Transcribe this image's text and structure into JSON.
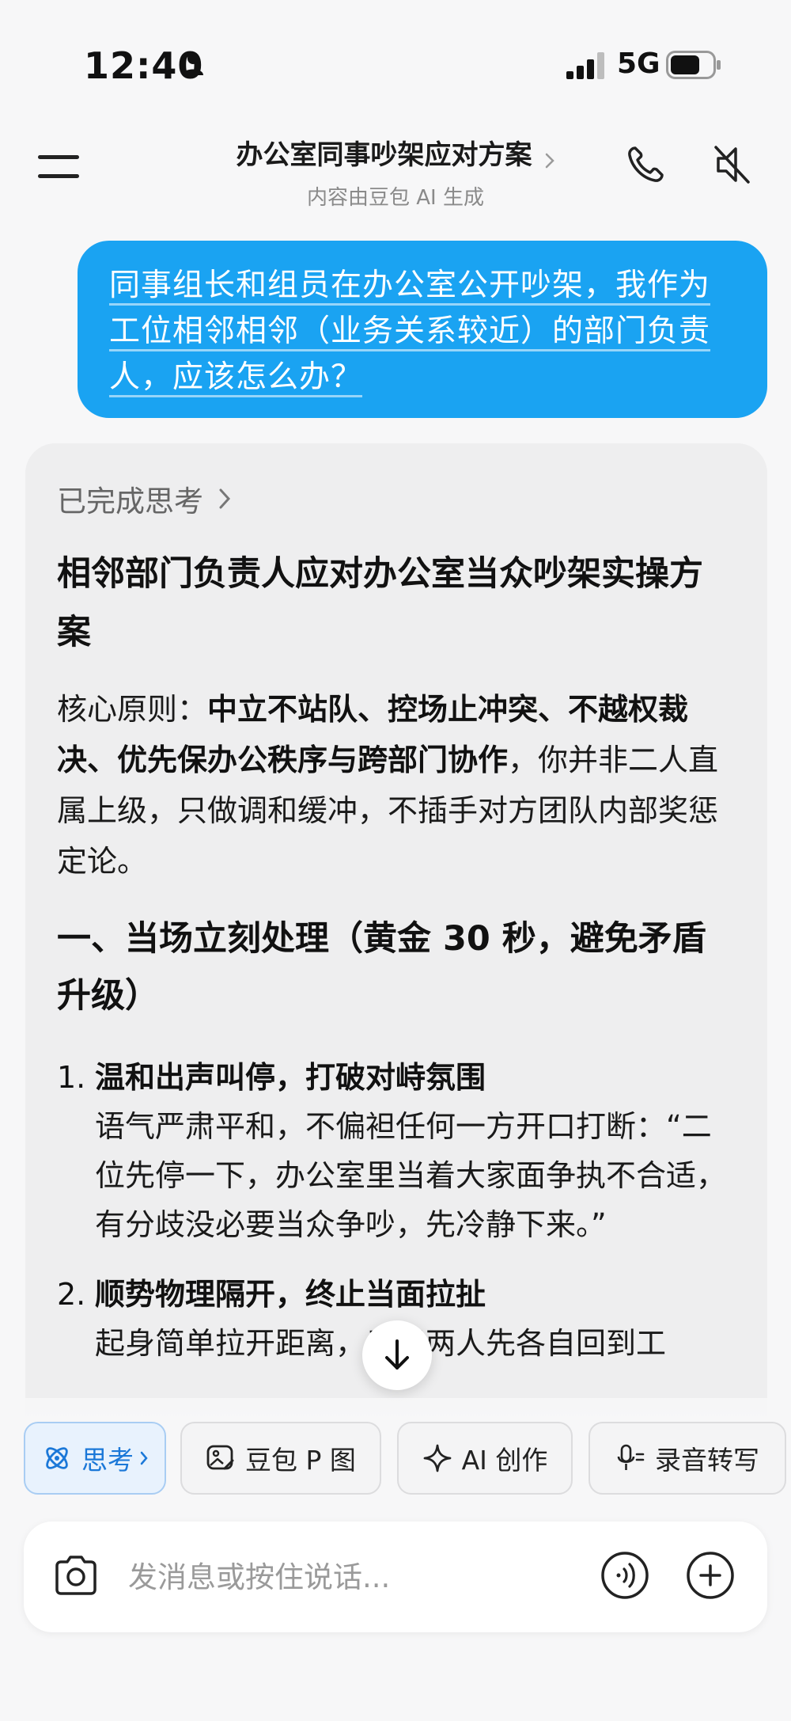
{
  "status_bar": {
    "time": "12:40",
    "network": "5G"
  },
  "header": {
    "title": "办公室同事吵架应对方案",
    "subtitle": "内容由豆包 AI 生成"
  },
  "user_message": "同事组长和组员在办公室公开吵架，我作为工位相邻相邻（业务关系较近）的部门负责人，应该怎么办？",
  "answer": {
    "thought_label": "已完成思考",
    "title": "相邻部门负责人应对办公室当众吵架实操方案",
    "principle_prefix": "核心原则：",
    "principle_bold": "中立不站队、控场止冲突、不越权裁决、优先保办公秩序与跨部门协作",
    "principle_rest": "，你并非二人直属上级，只做调和缓冲，不插手对方团队内部奖惩定论。",
    "section_title": "一、当场立刻处理（黄金 30 秒，避免矛盾升级）",
    "items": [
      {
        "num": "1.",
        "heading": "温和出声叫停，打破对峙氛围",
        "desc": "语气严肃平和，不偏袒任何一方开口打断：“二位先停一下，办公室里当着大家面争执不合适，有分歧没必要当众争吵，先冷静下来。”"
      },
      {
        "num": "2.",
        "heading": "顺势物理隔开，终止当面拉扯",
        "desc": "起身简单拉开距离，示意两人先各自回到工"
      }
    ]
  },
  "toolbar": {
    "chips": [
      {
        "label": "思考"
      },
      {
        "label": "豆包 P 图"
      },
      {
        "label": "AI 创作"
      },
      {
        "label": "录音转写"
      }
    ]
  },
  "input": {
    "placeholder": "发消息或按住说话..."
  },
  "colors": {
    "bubble": "#1aa3f2",
    "accent": "#1b78d8",
    "card": "#eeeeef"
  }
}
